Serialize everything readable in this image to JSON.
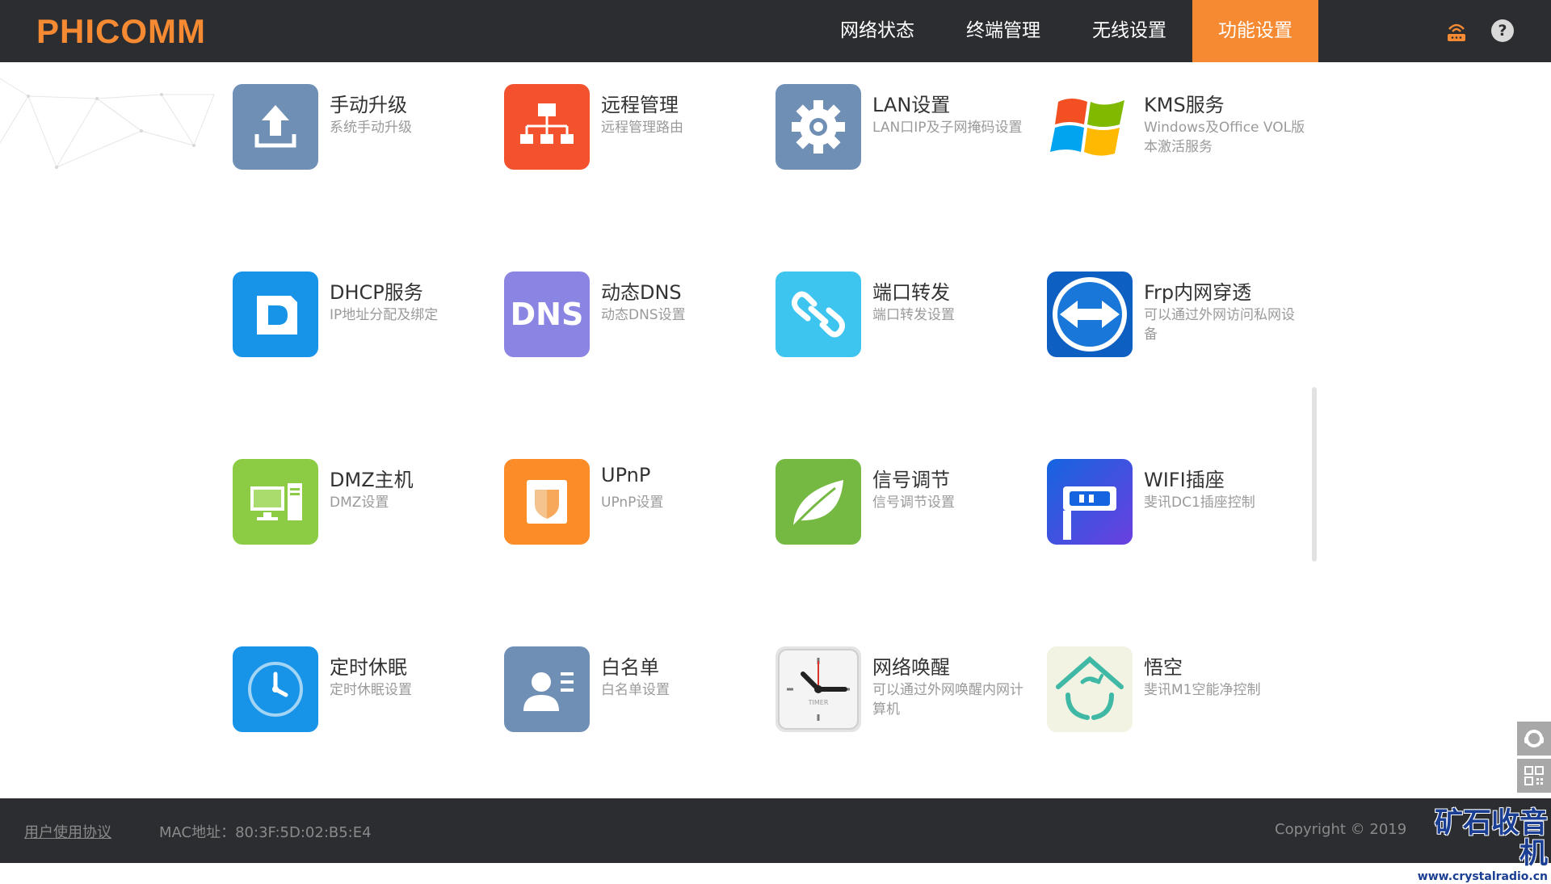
{
  "header": {
    "logo": "PHICOMM",
    "nav": [
      {
        "label": "网络状态"
      },
      {
        "label": "终端管理"
      },
      {
        "label": "无线设置"
      },
      {
        "label": "功能设置"
      }
    ],
    "help": "?"
  },
  "tiles": [
    {
      "title": "手动升级",
      "desc": "系统手动升级"
    },
    {
      "title": "远程管理",
      "desc": "远程管理路由"
    },
    {
      "title": "LAN设置",
      "desc": "LAN口IP及子网掩码设置"
    },
    {
      "title": "KMS服务",
      "desc": "Windows及Office VOL版本激活服务"
    },
    {
      "title": "DHCP服务",
      "desc": "IP地址分配及绑定"
    },
    {
      "title": "动态DNS",
      "desc": "动态DNS设置"
    },
    {
      "title": "端口转发",
      "desc": "端口转发设置"
    },
    {
      "title": "Frp内网穿透",
      "desc": "可以通过外网访问私网设备"
    },
    {
      "title": "DMZ主机",
      "desc": "DMZ设置"
    },
    {
      "title": "UPnP",
      "desc": "UPnP设置"
    },
    {
      "title": "信号调节",
      "desc": "信号调节设置"
    },
    {
      "title": "WIFI插座",
      "desc": "斐讯DC1插座控制"
    },
    {
      "title": "定时休眠",
      "desc": "定时休眠设置"
    },
    {
      "title": "白名单",
      "desc": "白名单设置"
    },
    {
      "title": "网络唤醒",
      "desc": "可以通过外网唤醒内网计算机"
    },
    {
      "title": "悟空",
      "desc": "斐讯M1空能净控制"
    }
  ],
  "icons": {
    "dns_text": "DNS",
    "timer_text": "TIMER"
  },
  "footer": {
    "agreement": "用户使用协议",
    "mac": "MAC地址：80:3F:5D:02:B5:E4",
    "copyright": "Copyright © 2019"
  },
  "watermark": {
    "line1": "矿石收音机",
    "line2": "www.crystalradio.cn"
  },
  "colors": {
    "header_bg": "#2b2d31",
    "accent": "#f58a32"
  }
}
